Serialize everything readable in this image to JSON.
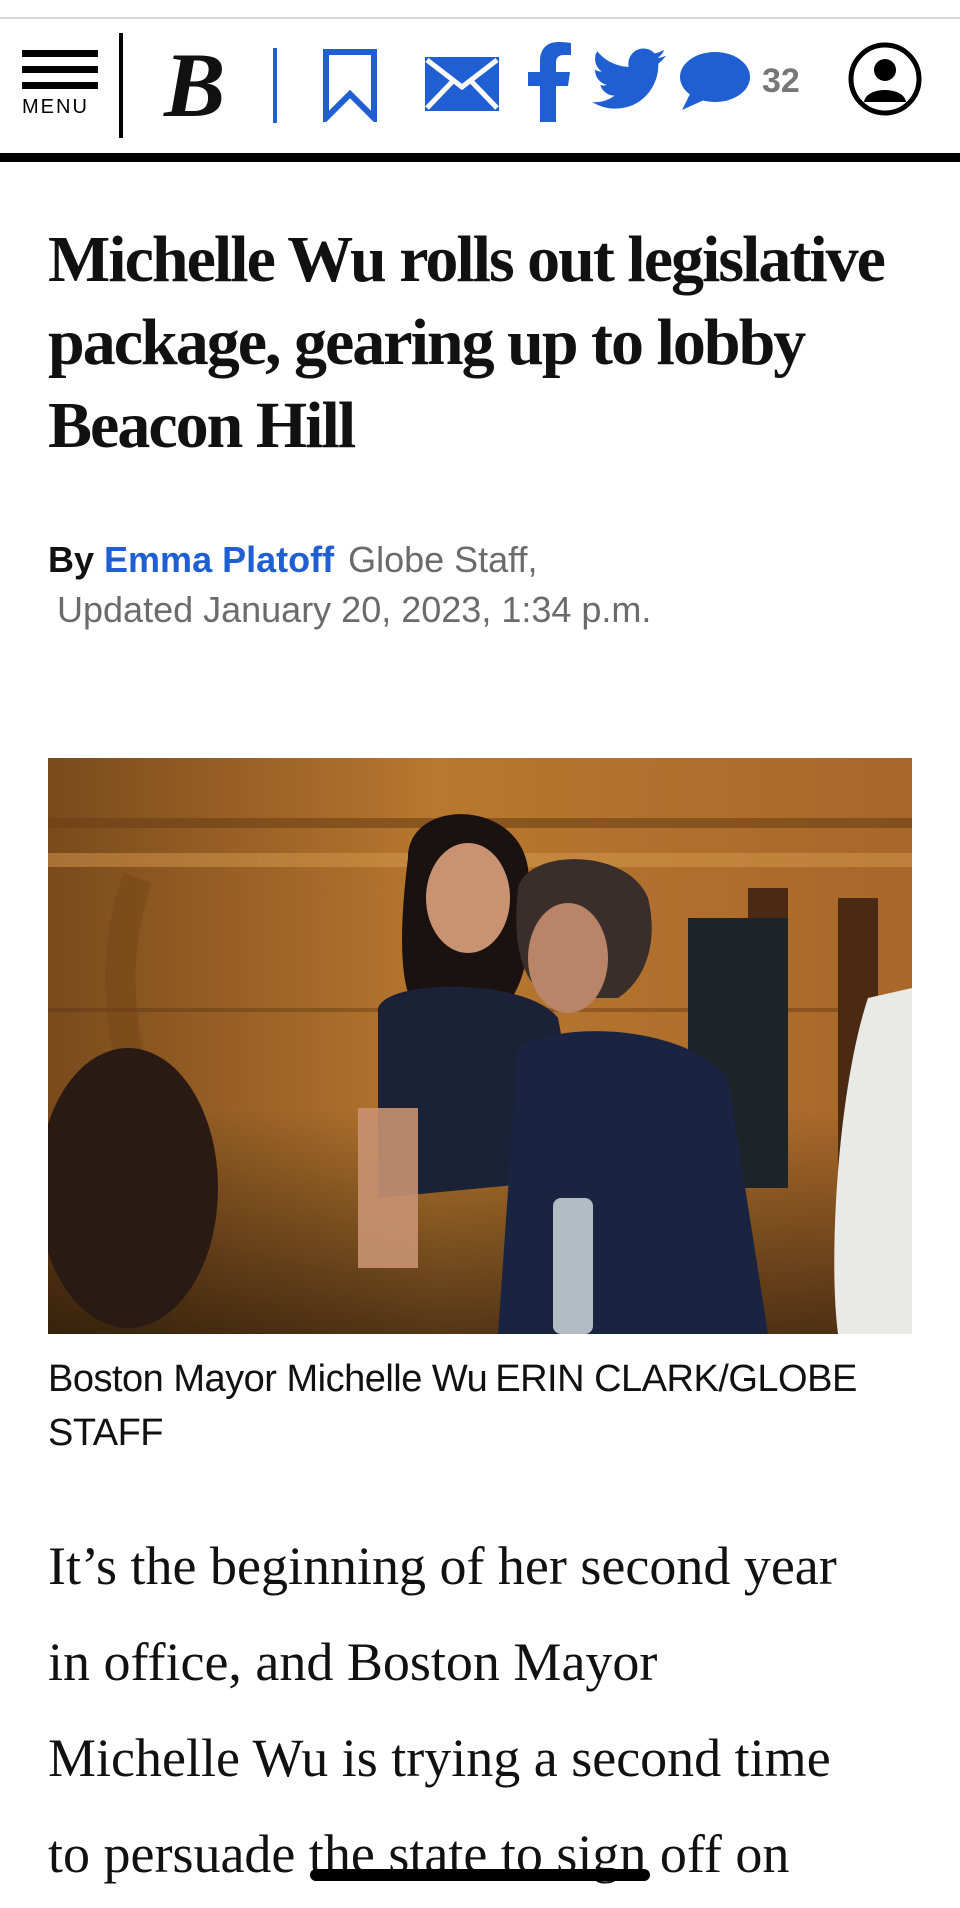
{
  "header": {
    "menu_label": "MENU",
    "logo_letter": "B",
    "comment_count": "32"
  },
  "article": {
    "headline": "Michelle Wu rolls out legislative package, gearing up to lobby Beacon Hill",
    "by_label": "By",
    "author": "Emma Platoff",
    "staff": "Globe Staff,",
    "updated": "Updated January 20, 2023, 1:34 p.m.",
    "caption_text": "Boston Mayor Michelle Wu",
    "caption_credit": "ERIN CLARK/GLOBE STAFF",
    "body_lines": [
      "It’s the beginning of her second year",
      "in office, and Boston Mayor",
      "Michelle Wu is trying a second time",
      "to persuade the state to sign off on"
    ]
  },
  "colors": {
    "accent": "#1f5fd1",
    "rule": "#000000",
    "muted": "#6b6b6b"
  }
}
